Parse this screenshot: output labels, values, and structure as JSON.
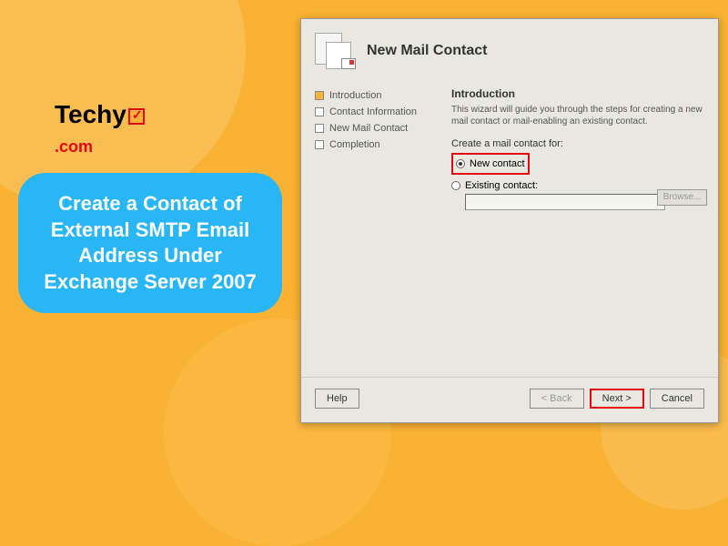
{
  "logo": {
    "text1": "Techy",
    "text2": ".com"
  },
  "bubble": {
    "text": "Create a Contact of External SMTP Email Address Under Exchange Server 2007"
  },
  "dialog": {
    "title": "New Mail Contact",
    "steps": [
      {
        "label": "Introduction",
        "active": true
      },
      {
        "label": "Contact Information",
        "active": false
      },
      {
        "label": "New Mail Contact",
        "active": false
      },
      {
        "label": "Completion",
        "active": false
      }
    ],
    "content": {
      "heading": "Introduction",
      "description": "This wizard will guide you through the steps for creating a new mail contact or mail-enabling an existing contact.",
      "fieldLabel": "Create a mail contact for:",
      "option1": "New contact",
      "option2": "Existing contact:",
      "browseLabel": "Browse..."
    },
    "buttons": {
      "help": "Help",
      "back": "< Back",
      "next": "Next >",
      "cancel": "Cancel"
    }
  }
}
